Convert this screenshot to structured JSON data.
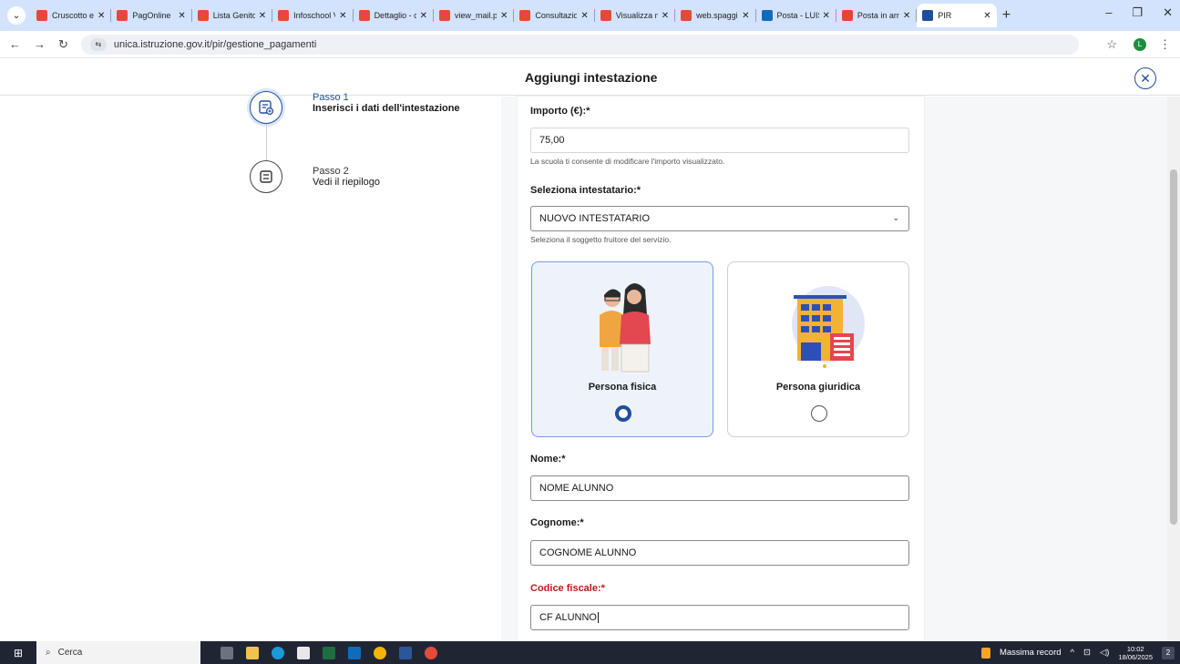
{
  "browser": {
    "tabs": [
      {
        "title": "Cruscotto e",
        "favicon": "scuola-favicon",
        "color": "#e24b3b"
      },
      {
        "title": "PagOnline",
        "favicon": "scuola-favicon",
        "color": "#e24b3b"
      },
      {
        "title": "Lista Genito",
        "favicon": "scuola-favicon",
        "color": "#e24b3b"
      },
      {
        "title": "Infoschool V",
        "favicon": "scuola-favicon",
        "color": "#e24b3b"
      },
      {
        "title": "Dettaglio - c",
        "favicon": "scuola-favicon",
        "color": "#e24b3b"
      },
      {
        "title": "view_mail.pl",
        "favicon": "scuola-favicon",
        "color": "#e24b3b"
      },
      {
        "title": "Consultazion",
        "favicon": "scuola-favicon",
        "color": "#e24b3b"
      },
      {
        "title": "Visualizza m",
        "favicon": "scuola-favicon",
        "color": "#e24b3b"
      },
      {
        "title": "web.spaggia",
        "favicon": "scuola-favicon",
        "color": "#e24b3b"
      },
      {
        "title": "Posta - LUIS",
        "favicon": "outlook-favicon",
        "color": "#0f6cbd"
      },
      {
        "title": "Posta in arri",
        "favicon": "gmail-favicon",
        "color": "#ea4335"
      },
      {
        "title": "PIR",
        "favicon": "pir-favicon",
        "color": "#1f4e9c",
        "active": true
      }
    ],
    "url": "unica.istruzione.gov.it/pir/gestione_pagamenti"
  },
  "modal": {
    "title": "Aggiungi intestazione"
  },
  "stepper": {
    "steps": [
      {
        "number": "Passo 1",
        "label": "Inserisci i dati dell'intestazione"
      },
      {
        "number": "Passo 2",
        "label": "Vedi il riepilogo"
      }
    ]
  },
  "form": {
    "importo": {
      "label": "Importo (€):*",
      "value": "75,00",
      "hint": "La scuola ti consente di modificare l'importo visualizzato."
    },
    "intestatario": {
      "label": "Seleziona intestatario:*",
      "value": "NUOVO INTESTATARIO",
      "hint": "Seleziona il soggetto fruitore del servizio."
    },
    "tipo": {
      "options": [
        {
          "label": "Persona fisica",
          "selected": true
        },
        {
          "label": "Persona giuridica",
          "selected": false
        }
      ]
    },
    "nome": {
      "label": "Nome:*",
      "value": "NOME ALUNNO"
    },
    "cognome": {
      "label": "Cognome:*",
      "value": "COGNOME ALUNNO"
    },
    "codice_fiscale": {
      "label": "Codice fiscale:*",
      "value": "CF ALUNNO"
    }
  },
  "taskbar": {
    "search": "Cerca",
    "weather": "Massima record",
    "time": "10:02",
    "date": "18/06/2025",
    "notifications": "2"
  },
  "colors": {
    "primary": "#1f4e9c",
    "error": "#b71c1c",
    "tabstrip": "#d3e3fd"
  }
}
